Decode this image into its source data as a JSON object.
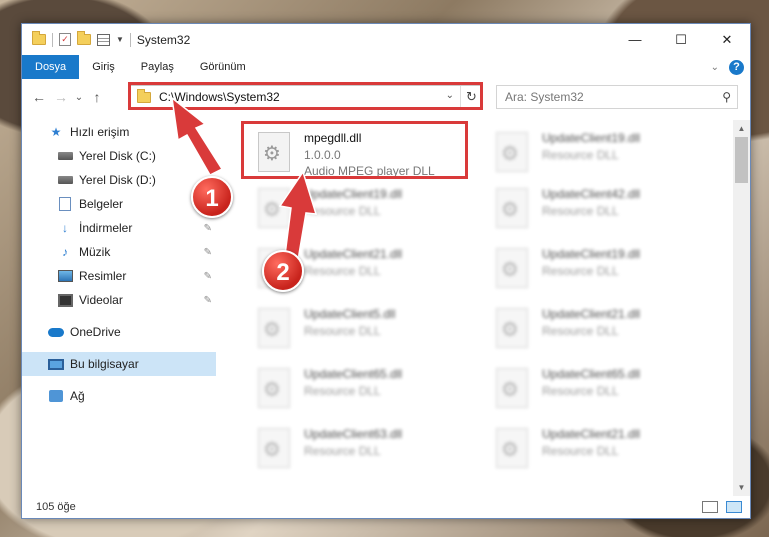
{
  "window": {
    "title": "System32",
    "controls": {
      "minimize": "—",
      "maximize": "☐",
      "close": "✕"
    }
  },
  "ribbon": {
    "tabs": [
      "Dosya",
      "Giriş",
      "Paylaş",
      "Görünüm"
    ],
    "active_tab": "Dosya",
    "expand_glyph": "⌄",
    "help_glyph": "?"
  },
  "nav": {
    "back": "←",
    "forward": "→",
    "recent": "⌄",
    "up": "↑",
    "address_path": "C:\\Windows\\System32",
    "address_dropdown": "⌄",
    "refresh": "↻",
    "search_placeholder": "Ara: System32",
    "search_glyph": "⚲"
  },
  "sidebar": {
    "quick_access": "Hızlı erişim",
    "items": [
      {
        "label": "Yerel Disk (C:)",
        "icon": "disk-icon",
        "pinned": true
      },
      {
        "label": "Yerel Disk (D:)",
        "icon": "disk-icon",
        "pinned": false
      },
      {
        "label": "Belgeler",
        "icon": "documents-icon",
        "pinned": false
      },
      {
        "label": "İndirmeler",
        "icon": "downloads-icon",
        "pinned": true
      },
      {
        "label": "Müzik",
        "icon": "music-icon",
        "pinned": true
      },
      {
        "label": "Resimler",
        "icon": "pictures-icon",
        "pinned": true
      },
      {
        "label": "Videolar",
        "icon": "videos-icon",
        "pinned": true
      }
    ],
    "onedrive": "OneDrive",
    "this_pc": "Bu bilgisayar",
    "network": "Ağ",
    "pin_glyph": "📌"
  },
  "files": [
    {
      "name": "mpegdll.dll",
      "line2": "1.0.0.0",
      "line3": "Audio MPEG player DLL",
      "highlighted": true
    },
    {
      "name": "UpdateClient19.dll",
      "line2": "Resource DLL",
      "line3": ""
    },
    {
      "name": "UpdateClient19.dll",
      "line2": "Resource DLL",
      "line3": ""
    },
    {
      "name": "UpdateClient42.dll",
      "line2": "Resource DLL",
      "line3": ""
    },
    {
      "name": "UpdateClient21.dll",
      "line2": "Resource DLL",
      "line3": ""
    },
    {
      "name": "UpdateClient19.dll",
      "line2": "Resource DLL",
      "line3": ""
    },
    {
      "name": "UpdateClient5.dll",
      "line2": "Resource DLL",
      "line3": ""
    },
    {
      "name": "UpdateClient21.dll",
      "line2": "Resource DLL",
      "line3": ""
    },
    {
      "name": "UpdateClient65.dll",
      "line2": "Resource DLL",
      "line3": ""
    },
    {
      "name": "UpdateClient65.dll",
      "line2": "Resource DLL",
      "line3": ""
    },
    {
      "name": "UpdateClient63.dll",
      "line2": "Resource DLL",
      "line3": ""
    },
    {
      "name": "UpdateClient21.dll",
      "line2": "Resource DLL",
      "line3": ""
    }
  ],
  "status": {
    "item_count": "105 öğe"
  },
  "annotations": {
    "step1": "1",
    "step2": "2",
    "color": "#d93a3a"
  }
}
